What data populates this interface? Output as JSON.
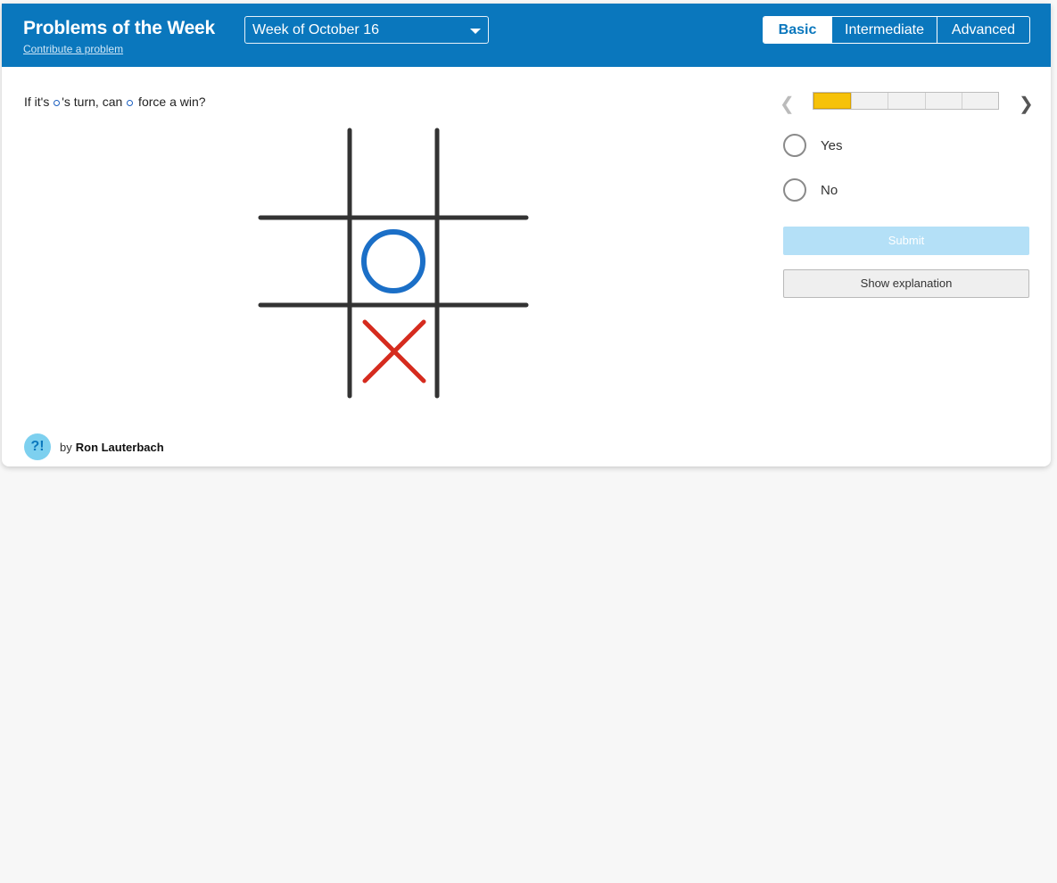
{
  "header": {
    "title": "Problems of the Week",
    "contribute_link": "Contribute a problem",
    "week_select": "Week of October 16",
    "levels": [
      "Basic",
      "Intermediate",
      "Advanced"
    ],
    "active_level": "Basic"
  },
  "problem": {
    "question_part1": "If it's ",
    "question_part2": "'s turn, can ",
    "question_part3": " force a win?",
    "board": {
      "cells": [
        "",
        "",
        "",
        "",
        "O",
        "",
        "",
        "X",
        ""
      ],
      "colors": {
        "o": "#1b6fc7",
        "x": "#d52b1e",
        "grid": "#333333"
      }
    }
  },
  "progress": {
    "current": 1,
    "total": 5,
    "fill_color": "#f6c20a"
  },
  "answers": {
    "options": [
      "Yes",
      "No"
    ]
  },
  "buttons": {
    "submit": "Submit",
    "explanation": "Show explanation"
  },
  "author": {
    "by": "by",
    "name": "Ron Lauterbach",
    "avatar_text": "?!"
  },
  "colors": {
    "brand": "#0a77bd",
    "submit_disabled": "#b4e0f7",
    "background": "#f7f7f7"
  }
}
